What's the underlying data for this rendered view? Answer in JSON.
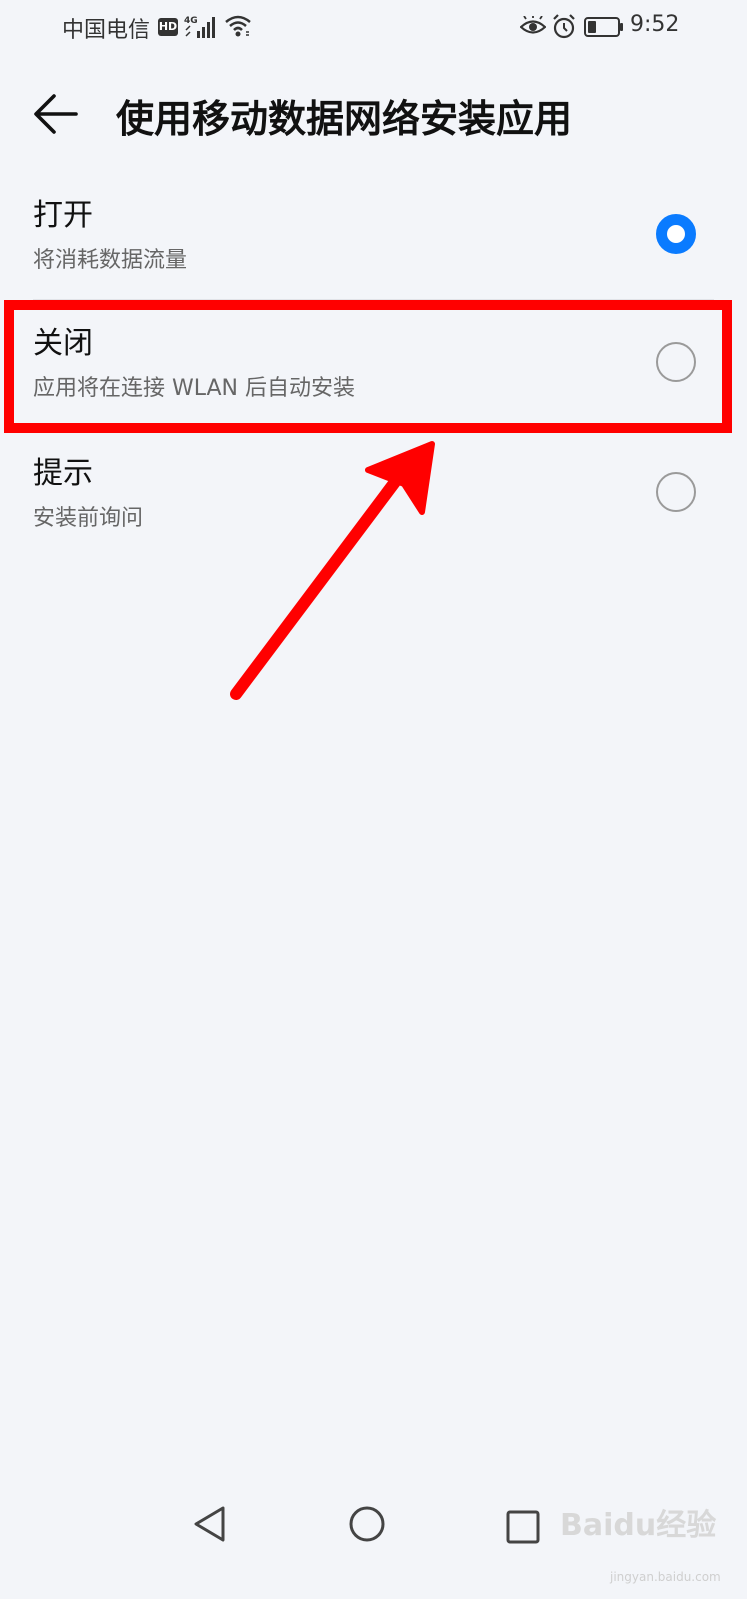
{
  "status_bar": {
    "carrier": "中国电信",
    "hd_badge": "HD",
    "network": "4G",
    "time": "9:52"
  },
  "header": {
    "title": "使用移动数据网络安装应用"
  },
  "options": [
    {
      "label": "打开",
      "desc": "将消耗数据流量",
      "selected": true
    },
    {
      "label": "关闭",
      "desc": "应用将在连接 WLAN 后自动安装",
      "selected": false
    },
    {
      "label": "提示",
      "desc": "安装前询问",
      "selected": false
    }
  ],
  "colors": {
    "accent": "#0a7bff",
    "annotation": "#ff0000",
    "background": "#f3f5f9"
  },
  "watermark": {
    "brand": "Baidu经验",
    "url": "jingyan.baidu.com"
  }
}
